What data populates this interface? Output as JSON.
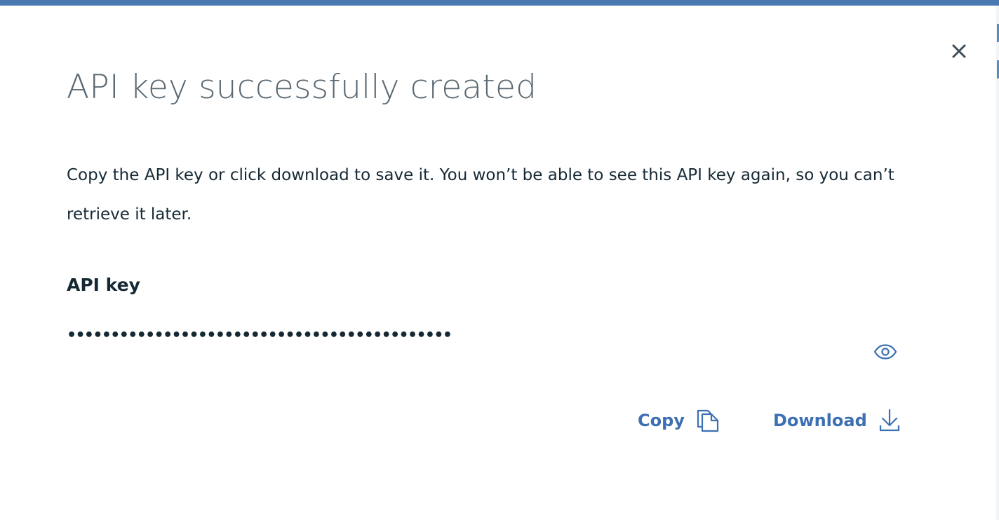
{
  "modal": {
    "title": "API key successfully created",
    "description": "Copy the API key or click download to save it. You won’t be able to see this API key again, so you can’t retrieve it later.",
    "close_icon": "close-icon"
  },
  "api_key": {
    "label": "API key",
    "masked_value": "••••••••••••••••••••••••••••••••••••••••••••",
    "toggle_icon": "eye-icon"
  },
  "actions": {
    "copy_label": "Copy",
    "copy_icon": "copy-icon",
    "download_label": "Download",
    "download_icon": "download-icon"
  },
  "colors": {
    "accent": "#3d70b2",
    "top_bar": "#4a78b0",
    "title": "#5a6872",
    "text": "#152935"
  }
}
